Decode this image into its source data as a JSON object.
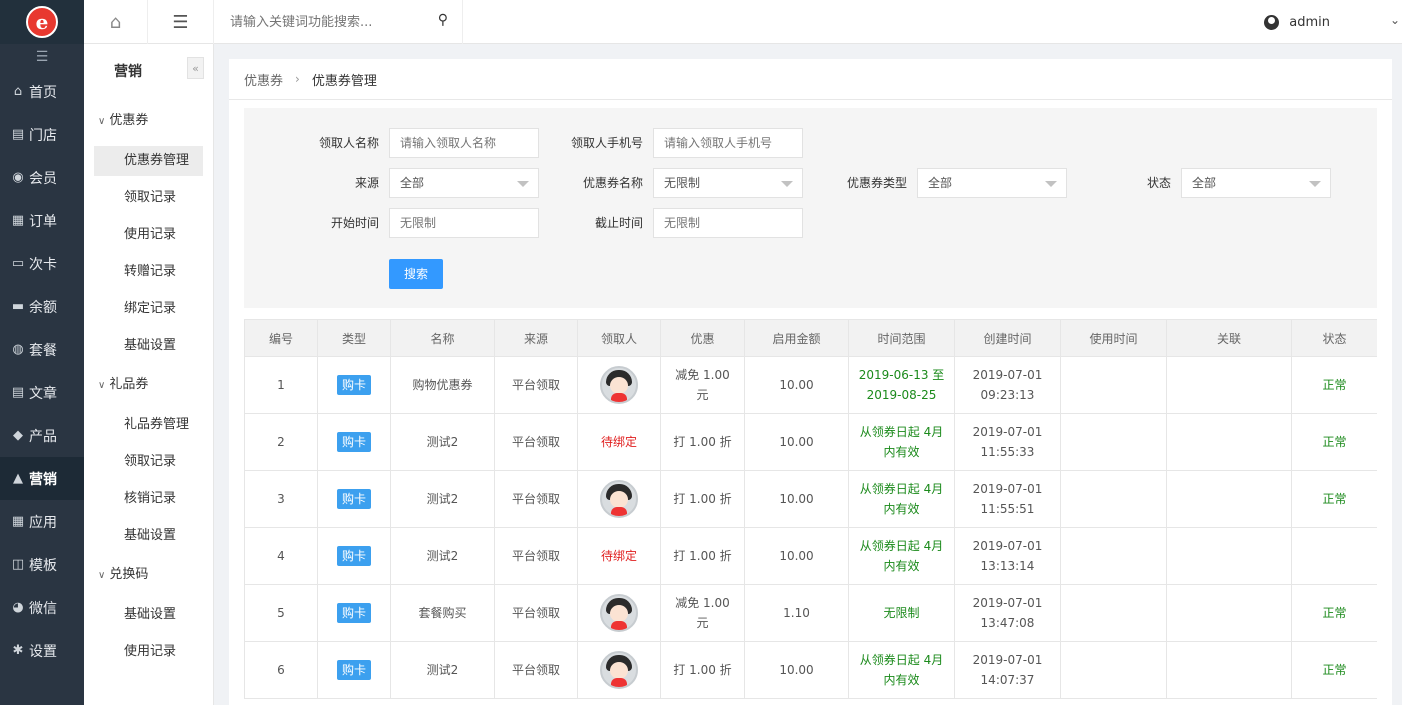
{
  "leftnav": {
    "items": [
      {
        "icon": "home-icon",
        "glyph": "⌂",
        "label": "首页"
      },
      {
        "icon": "store-icon",
        "glyph": "▤",
        "label": "门店"
      },
      {
        "icon": "member-icon",
        "glyph": "◉",
        "label": "会员"
      },
      {
        "icon": "order-icon",
        "glyph": "▦",
        "label": "订单"
      },
      {
        "icon": "card-icon",
        "glyph": "▭",
        "label": "次卡"
      },
      {
        "icon": "balance-icon",
        "glyph": "▬",
        "label": "余额"
      },
      {
        "icon": "package-icon",
        "glyph": "◍",
        "label": "套餐"
      },
      {
        "icon": "article-icon",
        "glyph": "▤",
        "label": "文章"
      },
      {
        "icon": "product-icon",
        "glyph": "◆",
        "label": "产品"
      },
      {
        "icon": "marketing-icon",
        "glyph": "▲",
        "label": "营销"
      },
      {
        "icon": "apps-icon",
        "glyph": "▦",
        "label": "应用"
      },
      {
        "icon": "template-icon",
        "glyph": "◫",
        "label": "模板"
      },
      {
        "icon": "wechat-icon",
        "glyph": "◕",
        "label": "微信"
      },
      {
        "icon": "settings-icon",
        "glyph": "✱",
        "label": "设置"
      }
    ],
    "active_index": 9
  },
  "topbar": {
    "search_placeholder": "请输入关键词功能搜索...",
    "user_name": "admin"
  },
  "subnav": {
    "title": "营销",
    "groups": [
      {
        "label": "优惠券",
        "items": [
          "优惠券管理",
          "领取记录",
          "使用记录",
          "转赠记录",
          "绑定记录",
          "基础设置"
        ]
      },
      {
        "label": "礼品券",
        "items": [
          "礼品券管理",
          "领取记录",
          "核销记录",
          "基础设置"
        ]
      },
      {
        "label": "兑换码",
        "items": [
          "基础设置",
          "使用记录"
        ]
      }
    ]
  },
  "breadcrumb": {
    "parent": "优惠券",
    "current": "优惠券管理"
  },
  "filter": {
    "receiver_name_label": "领取人名称",
    "receiver_name_placeholder": "请输入领取人名称",
    "receiver_phone_label": "领取人手机号",
    "receiver_phone_placeholder": "请输入领取人手机号",
    "source_label": "来源",
    "source_value": "全部",
    "coupon_name_label": "优惠券名称",
    "coupon_name_value": "无限制",
    "coupon_type_label": "优惠券类型",
    "coupon_type_value": "全部",
    "status_label": "状态",
    "status_value": "全部",
    "start_label": "开始时间",
    "start_placeholder": "无限制",
    "end_label": "截止时间",
    "end_placeholder": "无限制",
    "search_button": "搜索"
  },
  "table": {
    "columns": [
      "编号",
      "类型",
      "名称",
      "来源",
      "领取人",
      "优惠",
      "启用金额",
      "时间范围",
      "创建时间",
      "使用时间",
      "关联",
      "状态"
    ],
    "rows": [
      {
        "id": "1",
        "type": "购卡",
        "name": "购物优惠券",
        "source": "平台领取",
        "receiver": "avatar",
        "discount": "减免 1.00 元",
        "min_amount": "10.00",
        "range": "2019-06-13 至 2019-08-25",
        "created": "2019-07-01 09:23:13",
        "used": "",
        "link": "",
        "status": "正常"
      },
      {
        "id": "2",
        "type": "购卡",
        "name": "测试2",
        "source": "平台领取",
        "receiver": "待绑定",
        "discount": "打 1.00 折",
        "min_amount": "10.00",
        "range": "从领券日起 4月 内有效",
        "created": "2019-07-01 11:55:33",
        "used": "",
        "link": "",
        "status": "正常"
      },
      {
        "id": "3",
        "type": "购卡",
        "name": "测试2",
        "source": "平台领取",
        "receiver": "avatar",
        "discount": "打 1.00 折",
        "min_amount": "10.00",
        "range": "从领券日起 4月 内有效",
        "created": "2019-07-01 11:55:51",
        "used": "",
        "link": "",
        "status": "正常"
      },
      {
        "id": "4",
        "type": "购卡",
        "name": "测试2",
        "source": "平台领取",
        "receiver": "待绑定",
        "discount": "打 1.00 折",
        "min_amount": "10.00",
        "range": "从领券日起 4月 内有效",
        "created": "2019-07-01 13:13:14",
        "used": "",
        "link": "",
        "status": ""
      },
      {
        "id": "5",
        "type": "购卡",
        "name": "套餐购买",
        "source": "平台领取",
        "receiver": "avatar",
        "discount": "减免 1.00 元",
        "min_amount": "1.10",
        "range": "无限制",
        "created": "2019-07-01 13:47:08",
        "used": "",
        "link": "",
        "status": "正常"
      },
      {
        "id": "6",
        "type": "购卡",
        "name": "测试2",
        "source": "平台领取",
        "receiver": "avatar",
        "discount": "打 1.00 折",
        "min_amount": "10.00",
        "range": "从领券日起 4月 内有效",
        "created": "2019-07-01 14:07:37",
        "used": "",
        "link": "",
        "status": "正常"
      }
    ]
  }
}
